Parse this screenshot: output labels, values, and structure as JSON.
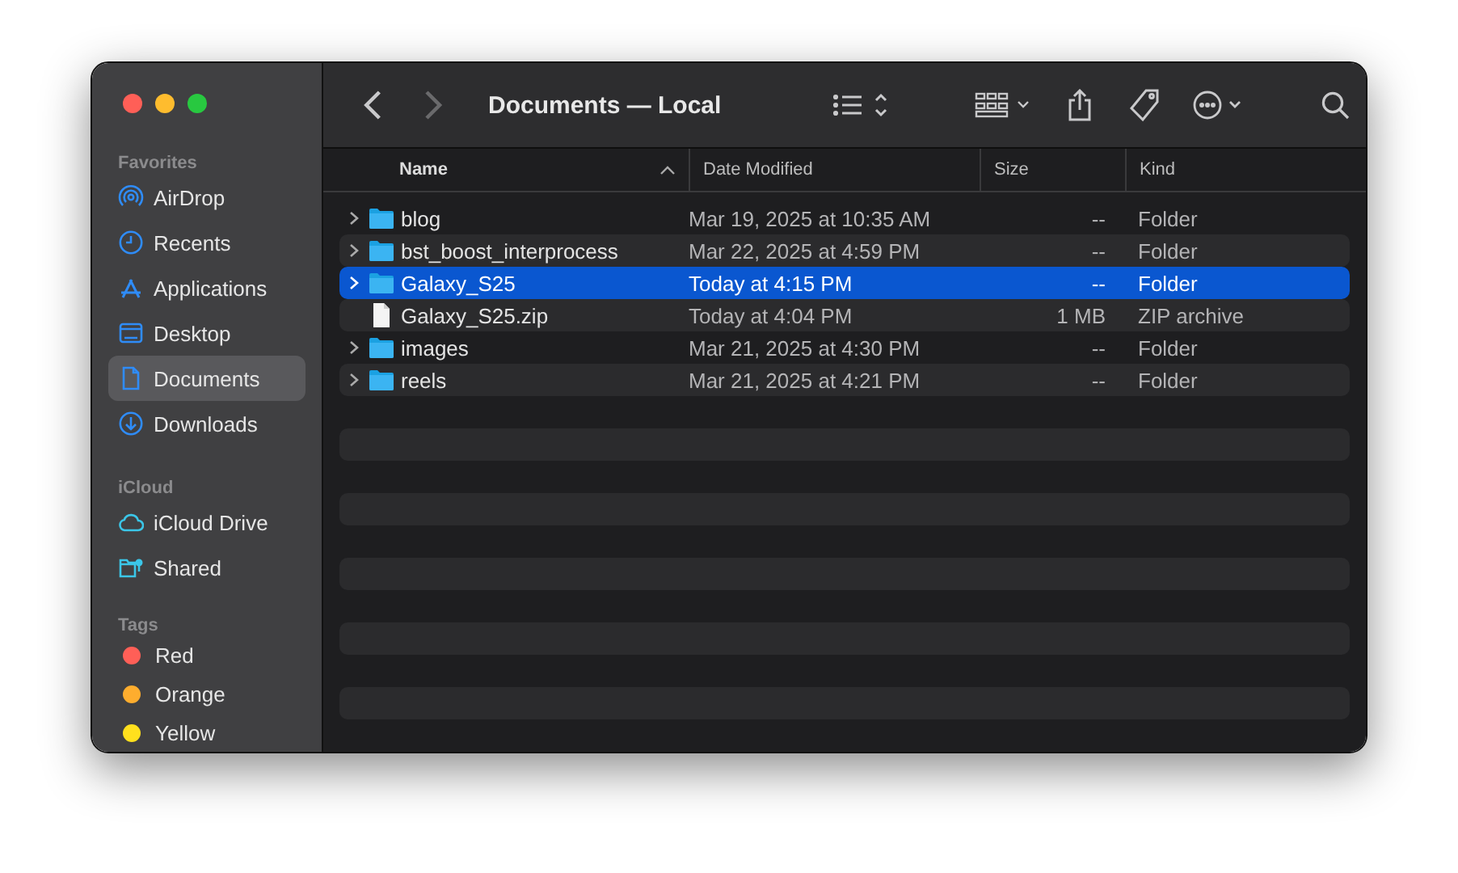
{
  "window": {
    "title": "Documents — Local"
  },
  "navigation": [
    {
      "kind": "back",
      "disabled": false
    },
    {
      "kind": "forward",
      "disabled": true
    }
  ],
  "sidebar": {
    "sections": [
      {
        "heading": "Favorites",
        "items": [
          {
            "label": "AirDrop",
            "kind": "airdrop",
            "selected": false
          },
          {
            "label": "Recents",
            "kind": "recents",
            "selected": false
          },
          {
            "label": "Applications",
            "kind": "applications",
            "selected": false
          },
          {
            "label": "Desktop",
            "kind": "desktop",
            "selected": false
          },
          {
            "label": "Documents",
            "kind": "documents",
            "selected": true
          },
          {
            "label": "Downloads",
            "kind": "downloads",
            "selected": false
          }
        ]
      },
      {
        "heading": "iCloud",
        "items": [
          {
            "label": "iCloud Drive",
            "kind": "cloud",
            "selected": false
          },
          {
            "label": "Shared",
            "kind": "shared",
            "selected": false
          }
        ]
      },
      {
        "heading": "Tags",
        "items": [
          {
            "label": "Red",
            "kind": "tag",
            "color": "#ff5f57",
            "selected": false
          },
          {
            "label": "Orange",
            "kind": "tag",
            "color": "#fead2e",
            "selected": false
          },
          {
            "label": "Yellow",
            "kind": "tag",
            "color": "#ffe01d",
            "selected": false
          }
        ]
      }
    ]
  },
  "table": {
    "columns": [
      {
        "label": "Name",
        "sorted": true
      },
      {
        "label": "Date Modified",
        "sorted": false
      },
      {
        "label": "Size",
        "sorted": false
      },
      {
        "label": "Kind",
        "sorted": false
      }
    ],
    "rows": [
      {
        "kind": "folder",
        "name": "blog",
        "date": "Mar 19, 2025 at 10:35 AM",
        "size": "--",
        "type": "Folder",
        "selected": false
      },
      {
        "kind": "folder",
        "name": "bst_boost_interprocess",
        "date": "Mar 22, 2025 at 4:59 PM",
        "size": "--",
        "type": "Folder",
        "selected": false
      },
      {
        "kind": "folder",
        "name": "Galaxy_S25",
        "date": "Today at 4:15 PM",
        "size": "--",
        "type": "Folder",
        "selected": true
      },
      {
        "kind": "file",
        "name": "Galaxy_S25.zip",
        "date": "Today at 4:04 PM",
        "size": "1 MB",
        "type": "ZIP archive",
        "selected": false
      },
      {
        "kind": "folder",
        "name": "images",
        "date": "Mar 21, 2025 at 4:30 PM",
        "size": "--",
        "type": "Folder",
        "selected": false
      },
      {
        "kind": "folder",
        "name": "reels",
        "date": "Mar 21, 2025 at 4:21 PM",
        "size": "--",
        "type": "Folder",
        "selected": false
      }
    ]
  }
}
